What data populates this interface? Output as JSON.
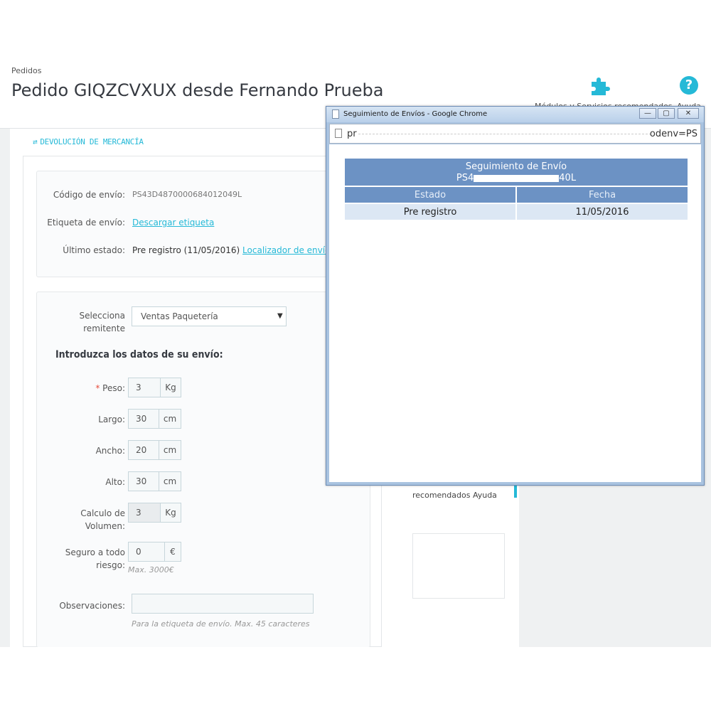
{
  "header": {
    "breadcrumb": "Pedidos",
    "title": "Pedido GIQZCVXUX desde Fernando Prueba",
    "modules_label": "Módulos y Servicios recomendados",
    "help_label": "Ayuda",
    "help_glyph": "?"
  },
  "left": {
    "return_link": "DEVOLUCIÓN DE MERCANCÍA",
    "shipping_code_label": "Código de envío:",
    "shipping_code_value": "PS43D4870000684012049L",
    "label_label": "Etiqueta de envío:",
    "label_link": "Descargar etiqueta",
    "last_status_label": "Último estado:",
    "last_status_value": "Pre registro (11/05/2016)",
    "tracker_link": "Localizador de envíos",
    "sender_label_1": "Selecciona",
    "sender_label_2": "remitente",
    "sender_value": "Ventas Paquetería",
    "section_title": "Introduzca los datos de su envío:",
    "fields": {
      "weight_label": "Peso:",
      "weight_value": "3",
      "weight_unit": "Kg",
      "length_label": "Largo:",
      "length_value": "30",
      "length_unit": "cm",
      "width_label": "Ancho:",
      "width_value": "20",
      "width_unit": "cm",
      "height_label": "Alto:",
      "height_value": "30",
      "height_unit": "cm",
      "volume_label_1": "Calculo de",
      "volume_label_2": "Volumen:",
      "volume_value": "3",
      "volume_unit": "Kg",
      "insurance_label_1": "Seguro a todo",
      "insurance_label_2": "riesgo:",
      "insurance_value": "0",
      "insurance_unit": "€",
      "insurance_help": "Max. 3000€",
      "notes_label": "Observaciones:",
      "notes_value": "",
      "notes_help": "Para la etiqueta de envío. Max. 45 caracteres"
    }
  },
  "background_right": {
    "label": "recomendados    Ayuda"
  },
  "popup": {
    "window_title": "Seguimiento de Envíos - Google Chrome",
    "url_left": "pr",
    "url_right": "odenv=PS",
    "btn_minimize": "—",
    "btn_restore": "▢",
    "btn_close": "✕",
    "table": {
      "title": "Seguimiento de Envío",
      "code_prefix": "PS4",
      "code_suffix": "40L",
      "col_status": "Estado",
      "col_date": "Fecha",
      "rows": [
        {
          "status": "Pre registro",
          "date": "11/05/2016"
        }
      ]
    }
  },
  "colors": {
    "accent": "#25b9d7",
    "table_header": "#6c92c4",
    "table_row": "#dce7f4"
  }
}
